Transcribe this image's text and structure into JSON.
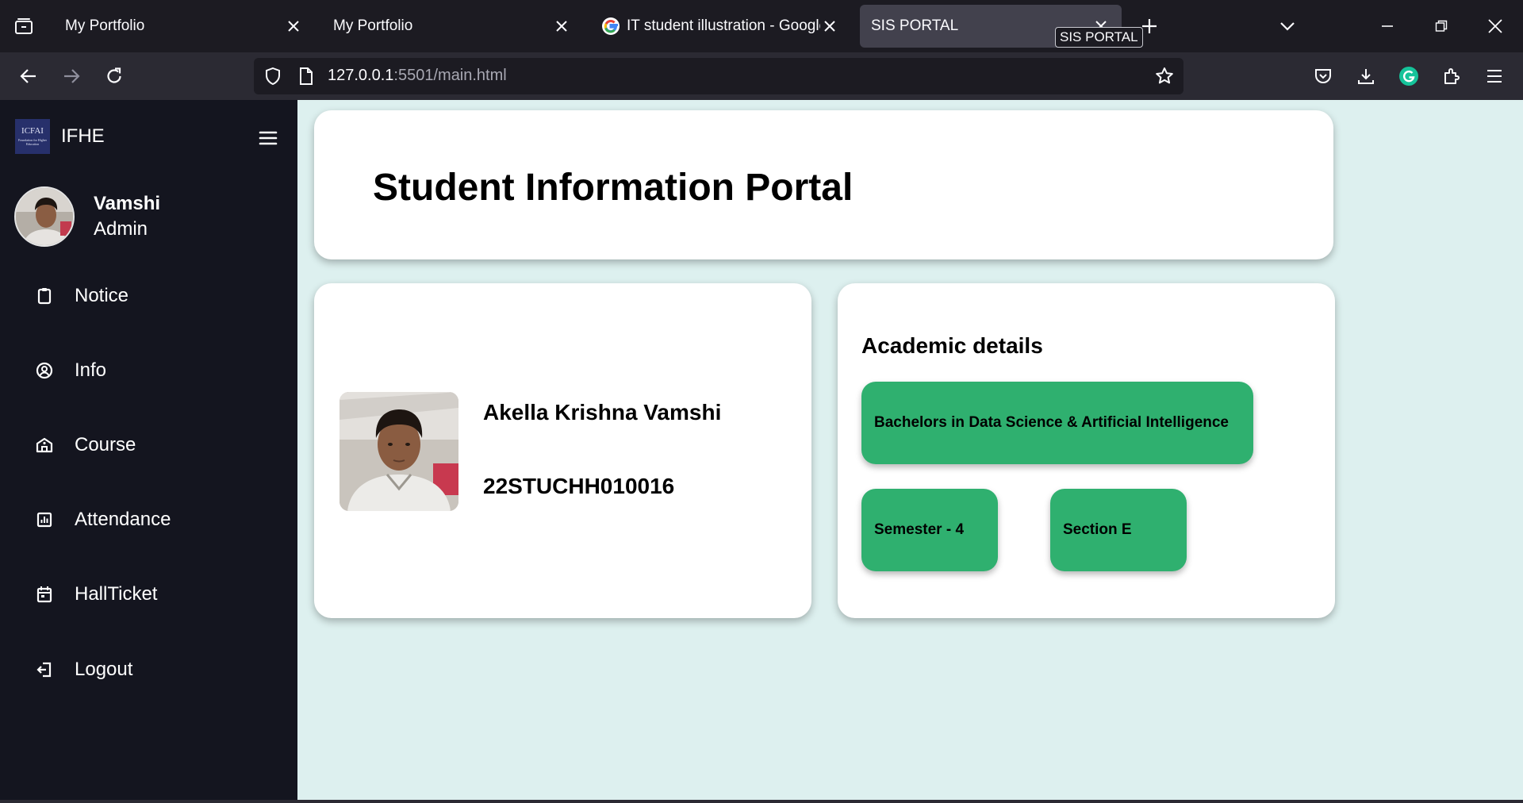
{
  "browser": {
    "tabs": [
      {
        "title": "My Portfolio",
        "active": false
      },
      {
        "title": "My Portfolio",
        "active": false
      },
      {
        "title": "IT student illustration - Google S",
        "active": false
      },
      {
        "title": "SIS PORTAL",
        "active": true
      }
    ],
    "tooltip": "SIS PORTAL",
    "url_host": "127.0.0.1",
    "url_rest": ":5501/main.html"
  },
  "sidebar": {
    "logo_text": "ICFAI",
    "logo_subtext": "Foundation for Higher Education",
    "brand": "IFHE",
    "user_name": "Vamshi",
    "user_role": "Admin",
    "items": [
      {
        "label": "Notice",
        "icon": "clipboard-icon"
      },
      {
        "label": "Info",
        "icon": "user-circle-icon"
      },
      {
        "label": "Course",
        "icon": "school-icon"
      },
      {
        "label": "Attendance",
        "icon": "bar-chart-icon"
      },
      {
        "label": "HallTicket",
        "icon": "calendar-icon"
      },
      {
        "label": "Logout",
        "icon": "logout-icon"
      }
    ]
  },
  "main": {
    "title": "Student Information Portal",
    "student": {
      "name": "Akella Krishna Vamshi",
      "id": "22STUCHH010016"
    },
    "academic": {
      "title": "Academic details",
      "degree": "Bachelors in Data Science & Artificial Intelligence",
      "semester": "Semester - 4",
      "section": "Section E"
    }
  },
  "colors": {
    "sidebar_bg": "#14151f",
    "page_bg": "#ddf0ef",
    "pill_green": "#2fb06f",
    "card_bg": "#ffffff"
  }
}
